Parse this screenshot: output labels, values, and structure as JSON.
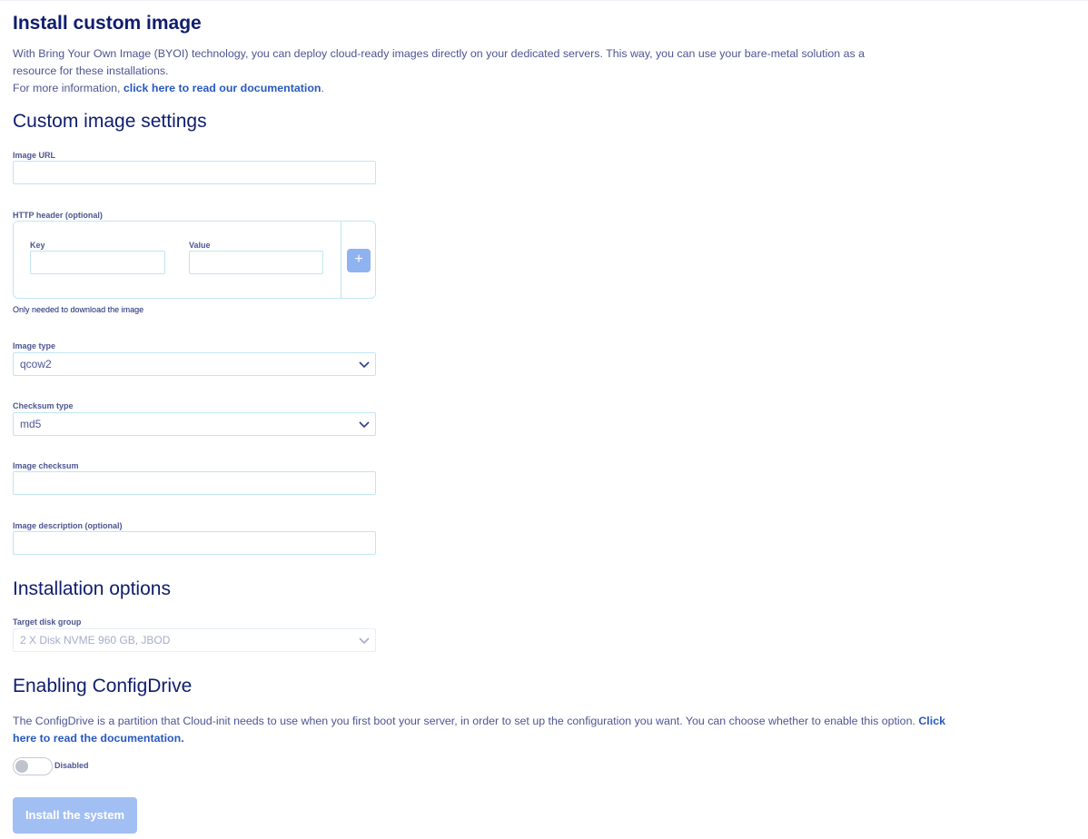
{
  "page": {
    "title": "Install custom image",
    "intro_text": "With Bring Your Own Image (BYOI) technology, you can deploy cloud-ready images directly on your dedicated servers. This way, you can use your bare-metal solution as a resource for these installations.",
    "more_info_prefix": "For more information, ",
    "more_info_link": "click here to read our documentation",
    "more_info_suffix": "."
  },
  "settings": {
    "heading": "Custom image settings",
    "image_url_label": "Image URL",
    "image_url_value": "",
    "http_header_label": "HTTP header (optional)",
    "key_label": "Key",
    "value_label": "Value",
    "add_icon": "+",
    "helper_text": "Only needed to download the image",
    "image_type_label": "Image type",
    "image_type_value": "qcow2",
    "checksum_type_label": "Checksum type",
    "checksum_type_value": "md5",
    "image_checksum_label": "Image checksum",
    "image_description_label": "Image description (optional)"
  },
  "installation": {
    "heading": "Installation options",
    "target_disk_label": "Target disk group",
    "target_disk_value": "2 X Disk NVME 960 GB, JBOD"
  },
  "configdrive": {
    "heading": "Enabling ConfigDrive",
    "text": "The ConfigDrive is a partition that Cloud-init needs to use when you first boot your server, in order to set up the configuration you want. You can choose whether to enable this option. ",
    "link": "Click here to read the documentation.",
    "toggle_label": "Disabled",
    "toggle_on": false
  },
  "actions": {
    "install_label": "Install the system"
  },
  "colors": {
    "heading": "#0f1d6e",
    "link": "#2859c0",
    "input_border": "#bfe6f2",
    "primary_disabled": "#a2bff4"
  }
}
